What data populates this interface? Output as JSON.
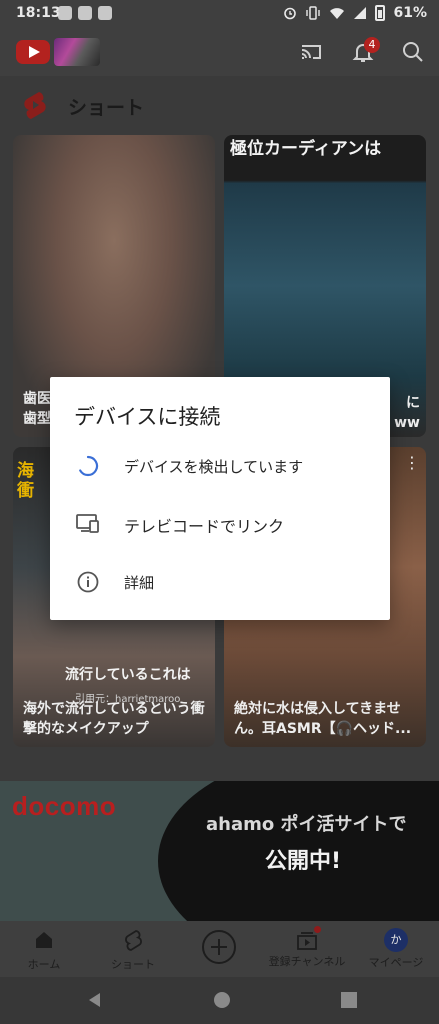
{
  "status_bar": {
    "time": "18:13",
    "battery": "61%"
  },
  "app_bar": {
    "notification_count": "4"
  },
  "shorts": {
    "section_title": "ショート",
    "cards": [
      {
        "caption": "歯医\n歯型"
      },
      {
        "top_text": "極位カーディアンは",
        "caption": "に\nww"
      },
      {
        "top_text": "海\n衝",
        "mid_text": "流行しているこれは",
        "small_text": "引用元：harrietmaroo",
        "caption": "海外で流行しているという衝撃的なメイクアップ"
      },
      {
        "caption": "絶対に水は侵入してきません。耳ASMR【🎧ヘッド..."
      }
    ]
  },
  "banner": {
    "brand": "docomo",
    "headline": "ahamo ポイ活サイトで",
    "subheadline": "公開中!"
  },
  "bottom_nav": {
    "home": "ホーム",
    "shorts": "ショート",
    "subscriptions": "登録チャンネル",
    "library": "マイページ",
    "avatar_letter": "か"
  },
  "dialog": {
    "title": "デバイスに接続",
    "options": [
      {
        "label": "デバイスを検出しています",
        "icon": "loading-spinner-icon"
      },
      {
        "label": "テレビコードでリンク",
        "icon": "tv-code-icon"
      },
      {
        "label": "詳細",
        "icon": "info-icon"
      }
    ]
  },
  "colors": {
    "accent": "#3b6fd6",
    "brand_red": "#b3221f"
  }
}
